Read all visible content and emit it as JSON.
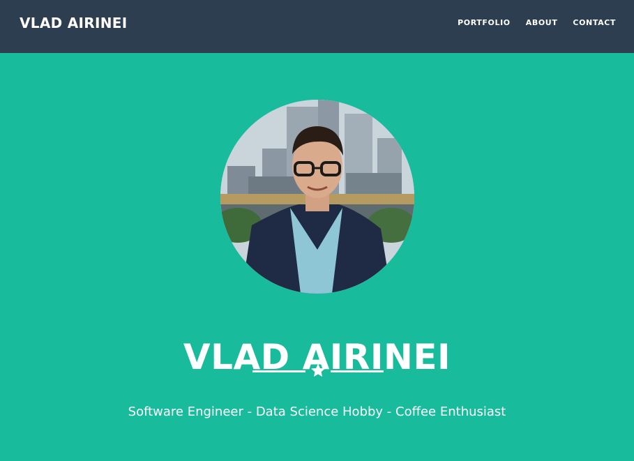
{
  "navbar": {
    "brand": "VLAD AIRINEI",
    "links": [
      "PORTFOLIO",
      "ABOUT",
      "CONTACT"
    ]
  },
  "hero": {
    "title": "VLAD AIRINEI",
    "subtitle": "Software Engineer - Data Science Hobby - Coffee Enthusiast",
    "divider_icon": "star-icon"
  },
  "colors": {
    "navbar_bg": "#2c3e50",
    "hero_bg": "#18bc9c",
    "text": "#ffffff"
  }
}
